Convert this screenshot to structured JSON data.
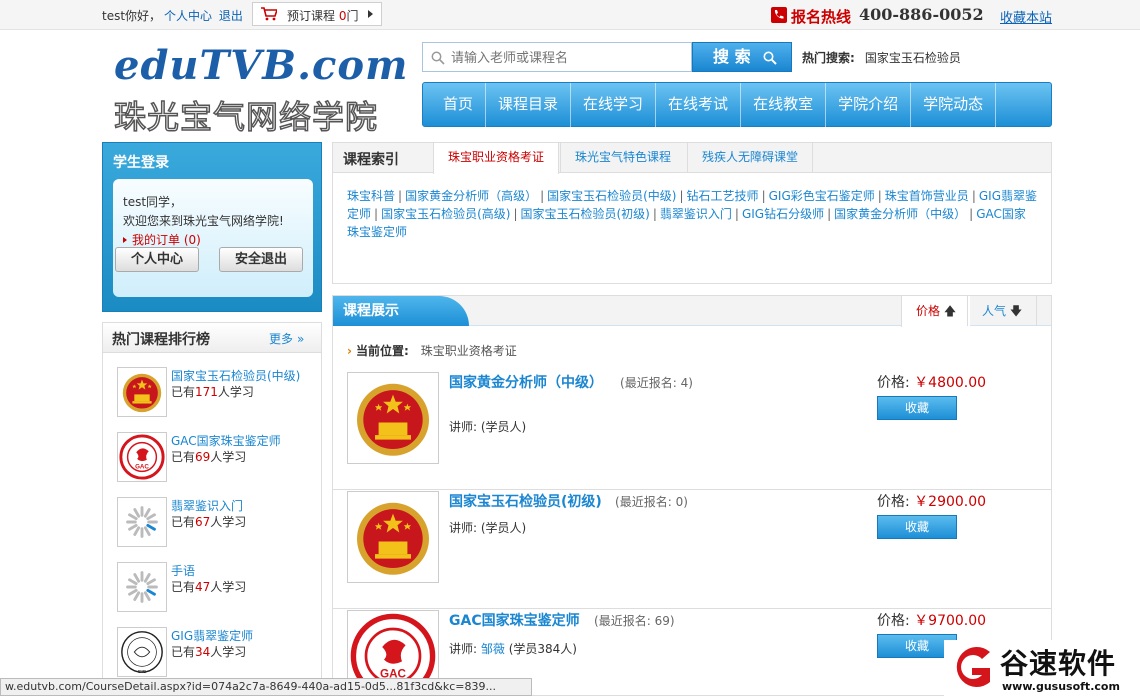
{
  "topbar": {
    "welcome": "test你好，",
    "personal_center": "个人中心",
    "logout": "退出",
    "cart_label": "预订课程",
    "cart_count": "0",
    "cart_unit": "门",
    "hotline_label": "报名热线",
    "hotline_number": "400-886-0052",
    "favorite_site": "收藏本站"
  },
  "logo": {
    "en": "eduTVB.com",
    "cn": "珠光宝气网络学院"
  },
  "search": {
    "placeholder": "请输入老师或课程名",
    "button": "搜 索",
    "hot_label": "热门搜索:",
    "hot_value": "国家宝玉石检验员"
  },
  "nav": [
    "首页",
    "课程目录",
    "在线学习",
    "在线考试",
    "在线教室",
    "学院介绍",
    "学院动态"
  ],
  "login": {
    "title": "学生登录",
    "line1": "test同学，",
    "line2": "欢迎您来到珠光宝气网络学院!",
    "orders_label": "我的订单",
    "orders_count": "(0)",
    "btn_center": "个人中心",
    "btn_logout": "安全退出"
  },
  "ranking": {
    "title": "热门课程排行榜",
    "more": "更多",
    "prefix": "已有",
    "suffix": "人学习",
    "items": [
      {
        "name": "国家宝玉石检验员(中级)",
        "count": "171",
        "thumb": "emblem"
      },
      {
        "name": "GAC国家珠宝鉴定师",
        "count": "69",
        "thumb": "gac"
      },
      {
        "name": "翡翠鉴识入门",
        "count": "67",
        "thumb": "loading"
      },
      {
        "name": "手语",
        "count": "47",
        "thumb": "loading"
      },
      {
        "name": "GIG翡翠鉴定师",
        "count": "34",
        "thumb": "gig"
      }
    ]
  },
  "course_index": {
    "title": "课程索引",
    "tabs": [
      "珠宝职业资格考证",
      "珠光宝气特色课程",
      "残疾人无障碍课堂"
    ],
    "links": [
      "珠宝科普",
      "国家黄金分析师（高级）",
      "国家宝玉石检验员(中级)",
      "钻石工艺技师",
      "GIG彩色宝石鉴定师",
      "珠宝首饰营业员",
      "GIG翡翠鉴定师",
      "国家宝玉石检验员(高级)",
      "国家宝玉石检验员(初级)",
      "翡翠鉴识入门",
      "GIG钻石分级师",
      "国家黄金分析师（中级）",
      "GAC国家珠宝鉴定师"
    ]
  },
  "course_display": {
    "title": "课程展示",
    "sort_price": "价格",
    "sort_popularity": "人气",
    "crumb_label": "当前位置:",
    "crumb_value": "珠宝职业资格考证",
    "recent_label": "最近报名:",
    "teacher_label": "讲师:",
    "price_label": "价格:",
    "fav_button": "收藏",
    "courses": [
      {
        "title": "国家黄金分析师（中级）",
        "recent": "4",
        "teacher_link": "",
        "teacher_rest": "(学员人)",
        "price": "￥4800.00",
        "thumb": "emblem"
      },
      {
        "title": "国家宝玉石检验员(初级)",
        "recent": "0",
        "teacher_link": "",
        "teacher_rest": "(学员人)",
        "price": "￥2900.00",
        "thumb": "emblem"
      },
      {
        "title": "GAC国家珠宝鉴定师",
        "recent": "69",
        "teacher_link": "邹薇",
        "teacher_rest": "(学员384人)",
        "price": "￥9700.00",
        "thumb": "gac"
      }
    ]
  },
  "statusbar": "w.edutvb.com/CourseDetail.aspx?id=074a2c7a-8649-440a-ad15-0d5...81f3cd&kc=839...",
  "watermark": {
    "cn": "谷速软件",
    "url": "www.gususoft.com"
  },
  "colors": {
    "accent": "#1a86d1",
    "price": "#cc0000",
    "link": "#0b63b6"
  }
}
